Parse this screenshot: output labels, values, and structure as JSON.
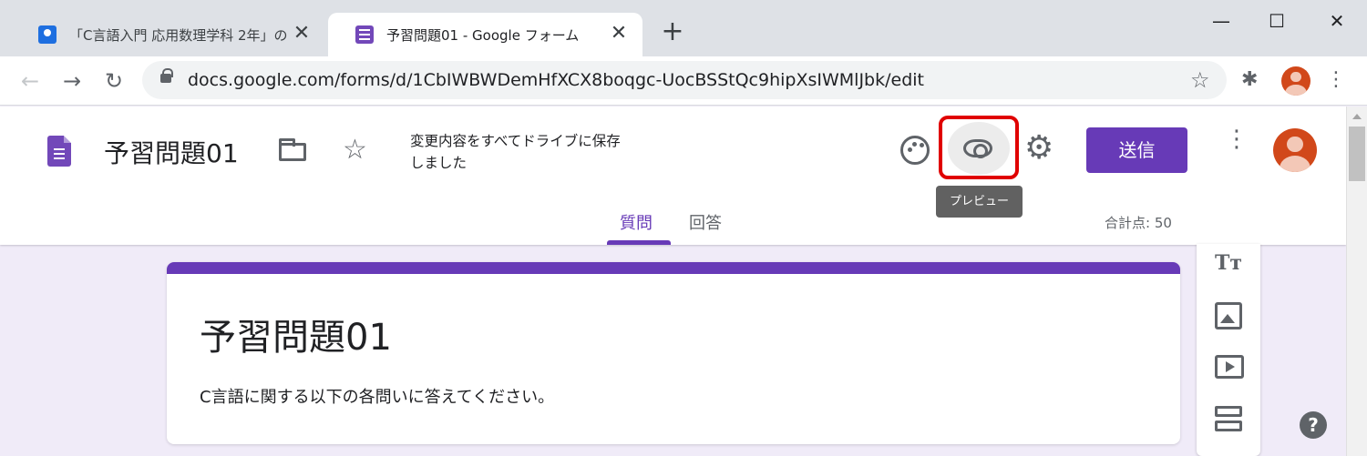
{
  "browser": {
    "tabs": [
      {
        "title": "「C言語入門 応用数理学科 2年」の",
        "favicon": "classroom-icon",
        "active": false
      },
      {
        "title": "予習問題01 - Google フォーム",
        "favicon": "forms-icon",
        "active": true
      }
    ],
    "new_tab_symbol": "+",
    "close_symbol": "✕",
    "window_controls": {
      "minimize": "—",
      "maximize": "☐",
      "close": "✕"
    },
    "url": "docs.google.com/forms/d/1CbIWBWDemHfXCX8boqgc-UocBSStQc9hipXsIWMlJbk/edit"
  },
  "forms_header": {
    "title": "予習問題01",
    "save_status": "変更内容をすべてドライブに保存しました",
    "send_label": "送信",
    "tooltip": "プレビュー",
    "tabs": [
      {
        "label": "質問",
        "active": true
      },
      {
        "label": "回答",
        "active": false
      }
    ],
    "total_points": "合計点: 50"
  },
  "form": {
    "title": "予習問題01",
    "description": "C言語に関する以下の各問いに答えてください。"
  },
  "side_toolbar": {
    "text_tool": "Tт"
  },
  "help_symbol": "?",
  "colors": {
    "forms_purple": "#673ab7",
    "background": "#f0ebf8",
    "highlight_red": "#e00000"
  }
}
